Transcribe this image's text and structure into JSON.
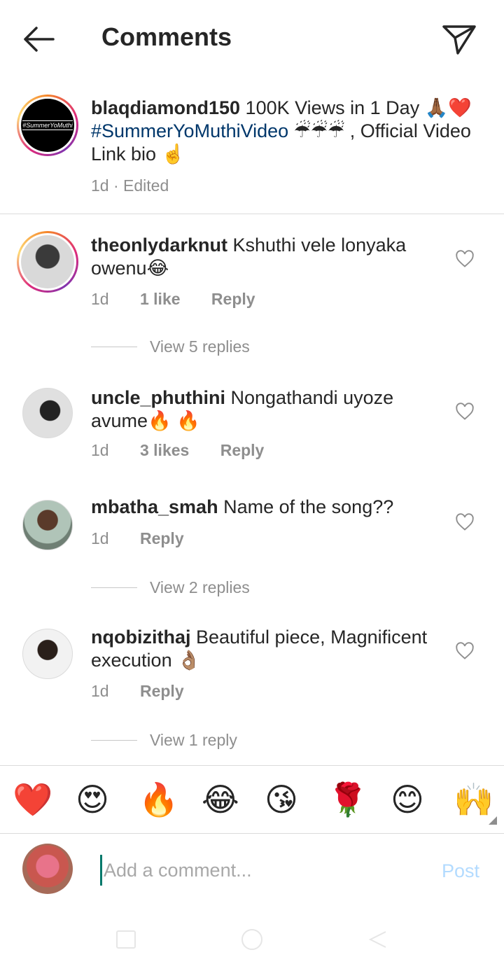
{
  "header": {
    "title": "Comments"
  },
  "caption": {
    "username": "blaqdiamond150",
    "text_before_hashtag": " 100K Views in 1 Day 🙏🏾❤️ ",
    "hashtag": "#SummerYoMuthiVideo",
    "text_after_hashtag": " ☔☔☔ , Official Video Link bio ☝️",
    "avatar_text": "#SummerYoMuthi",
    "time": "1d",
    "separator": " · ",
    "edited": "Edited"
  },
  "comments": [
    {
      "username": "theonlydarknut",
      "text": " Kshuthi vele lonyaka owenu😂",
      "time": "1d",
      "likes": "1 like",
      "reply": "Reply",
      "view_replies": "View 5 replies"
    },
    {
      "username": "uncle_phuthini",
      "text": " Nongathandi uyoze avume🔥 🔥",
      "time": "1d",
      "likes": "3 likes",
      "reply": "Reply",
      "view_replies": ""
    },
    {
      "username": "mbatha_smah",
      "text": " Name of the song??",
      "time": "1d",
      "likes": "",
      "reply": "Reply",
      "view_replies": "View 2 replies"
    },
    {
      "username": "nqobizithaj",
      "text": " Beautiful piece, Magnificent execution 👌🏽",
      "time": "1d",
      "likes": "",
      "reply": "Reply",
      "view_replies": "View 1 reply"
    }
  ],
  "emoji_bar": [
    "❤️",
    "😍",
    "🔥",
    "😂",
    "😘",
    "🌹",
    "😊",
    "🙌"
  ],
  "composer": {
    "placeholder": "Add a comment...",
    "post_label": "Post"
  },
  "colors": {
    "text": "#262626",
    "secondary": "#8e8e8e",
    "hashtag": "#00376b",
    "post_disabled": "#b3dbff"
  }
}
